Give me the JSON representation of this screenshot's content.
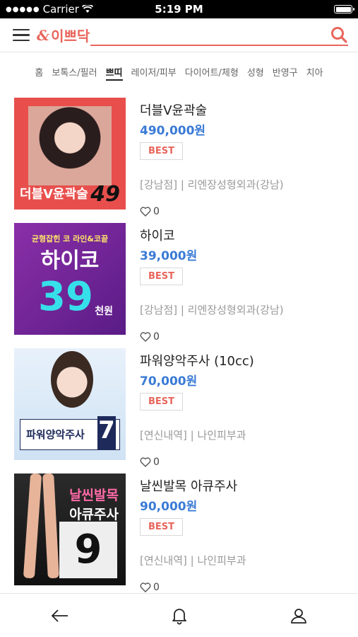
{
  "status": {
    "carrier": "Carrier",
    "time": "5:19 PM"
  },
  "header": {
    "logo_text": "이쁘닥",
    "logo_mark": "&"
  },
  "tabs": [
    {
      "label": "홈",
      "active": false
    },
    {
      "label": "보톡스/필러",
      "active": false
    },
    {
      "label": "쁘띠",
      "active": true
    },
    {
      "label": "레이저/피부",
      "active": false
    },
    {
      "label": "다이어트/체형",
      "active": false
    },
    {
      "label": "성형",
      "active": false
    },
    {
      "label": "반영구",
      "active": false
    },
    {
      "label": "치아",
      "active": false
    }
  ],
  "items": [
    {
      "name": "더블V윤곽술",
      "price": "490,000원",
      "badge": "BEST",
      "meta": "[강남점] | 리엔장성형외과(강남)",
      "likes": "0",
      "thumb": {
        "caption": "더블V윤곽술",
        "num": "49"
      }
    },
    {
      "name": "하이코",
      "price": "39,000원",
      "badge": "BEST",
      "meta": "[강남점] | 리엔장성형외과(강남)",
      "likes": "0",
      "thumb": {
        "top": "균형잡힌 코 라인&코끝",
        "big": "하이코",
        "num": "39",
        "unit": "천원"
      }
    },
    {
      "name": "파워양악주사 (10cc)",
      "price": "70,000원",
      "badge": "BEST",
      "meta": "[연신내역] | 나인피부과",
      "likes": "0",
      "thumb": {
        "caption": "파워양악주사",
        "num": "7"
      }
    },
    {
      "name": "날씬발목 아큐주사",
      "price": "90,000원",
      "badge": "BEST",
      "meta": "[연신내역] | 나인피부과",
      "likes": "0",
      "thumb": {
        "title1": "날씬발목",
        "title2": "아큐주사",
        "num": "9"
      }
    }
  ],
  "colors": {
    "accent": "#e8665c",
    "price": "#3a7bd5"
  }
}
